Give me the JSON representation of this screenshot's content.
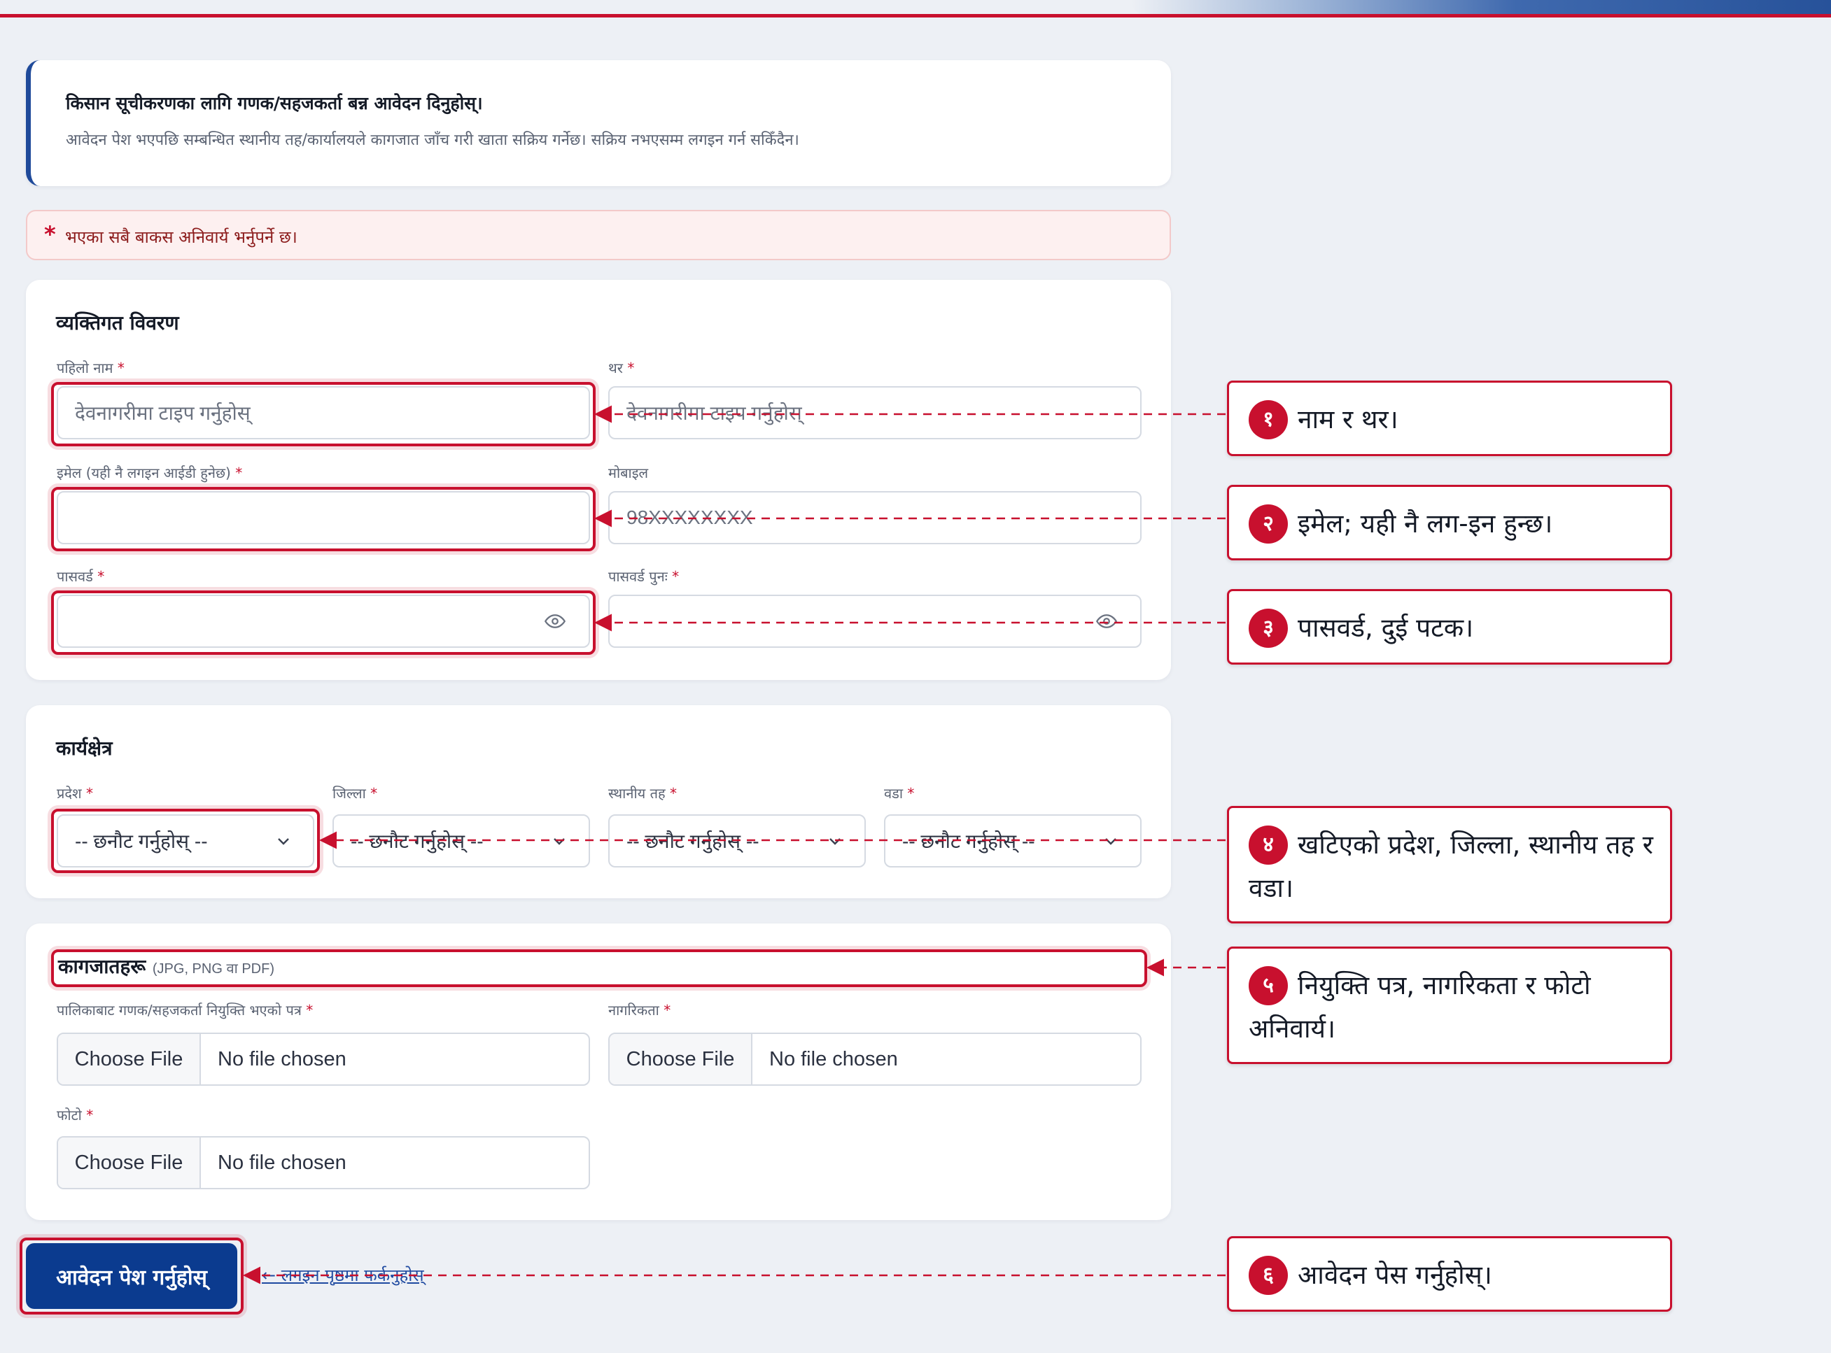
{
  "header": {
    "brand_colors": {
      "accent_red": "#c8102e",
      "navy": "#0b3b8f"
    }
  },
  "intro": {
    "heading": "किसान सूचीकरणका लागि गणक/सहजकर्ता बन्न आवेदन दिनुहोस्।",
    "description": "आवेदन पेश भएपछि सम्बन्धित स्थानीय तह/कार्यालयले कागजात जाँच गरी खाता सक्रिय गर्नेछ। सक्रिय नभएसम्म लगइन गर्न सकिँदैन।"
  },
  "required_notice": {
    "star": "*",
    "text": "भएका सबै बाकस अनिवार्य भर्नुपर्ने छ।"
  },
  "required_mark": "*",
  "personal": {
    "title": "व्यक्तिगत विवरण",
    "first_name": {
      "label": "पहिलो नाम",
      "placeholder": "देवनागरीमा टाइप गर्नुहोस्"
    },
    "last_name": {
      "label": "थर",
      "placeholder": "देवनागरीमा टाइप गर्नुहोस्"
    },
    "email": {
      "label": "इमेल (यही नै लगइन आईडी हुनेछ)",
      "value": ""
    },
    "mobile": {
      "label": "मोबाइल",
      "placeholder": "98XXXXXXXX"
    },
    "password": {
      "label": "पासवर्ड",
      "icon": "eye-icon"
    },
    "password_confirm": {
      "label": "पासवर्ड पुनः",
      "icon": "eye-icon"
    }
  },
  "work_area": {
    "title": "कार्यक्षेत्र",
    "province": {
      "label": "प्रदेश",
      "value": "-- छनौट गर्नुहोस् --"
    },
    "district": {
      "label": "जिल्ला",
      "value": "-- छनौट गर्नुहोस् --"
    },
    "local_level": {
      "label": "स्थानीय तह",
      "value": "-- छनौट गर्नुहोस् --"
    },
    "ward": {
      "label": "वडा",
      "value": "-- छनौट गर्नुहोस् --"
    }
  },
  "documents": {
    "title": "कागजातहरू",
    "hint": "(JPG, PNG वा PDF)",
    "appointment": {
      "label": "पालिकाबाट गणक/सहजकर्ता नियुक्ति भएको पत्र",
      "button": "Choose File",
      "status": "No file chosen"
    },
    "citizenship": {
      "label": "नागरिकता",
      "button": "Choose File",
      "status": "No file chosen"
    },
    "photo": {
      "label": "फोटो",
      "button": "Choose File",
      "status": "No file chosen"
    }
  },
  "actions": {
    "submit": "आवेदन पेश गर्नुहोस्",
    "back_link": "← लगइन पृष्ठमा फर्कनुहोस्"
  },
  "callouts": [
    {
      "num": "१",
      "text": "नाम र थर।"
    },
    {
      "num": "२",
      "text": "इमेल; यही नै लग-इन हुन्छ।"
    },
    {
      "num": "३",
      "text": "पासवर्ड, दुई पटक।"
    },
    {
      "num": "४",
      "text": "खटिएको प्रदेश, जिल्ला, स्थानीय तह र वडा।"
    },
    {
      "num": "५",
      "text": "नियुक्ति पत्र, नागरिकता र फोटो अनिवार्य।"
    },
    {
      "num": "६",
      "text": "आवेदन पेस गर्नुहोस्।"
    }
  ]
}
